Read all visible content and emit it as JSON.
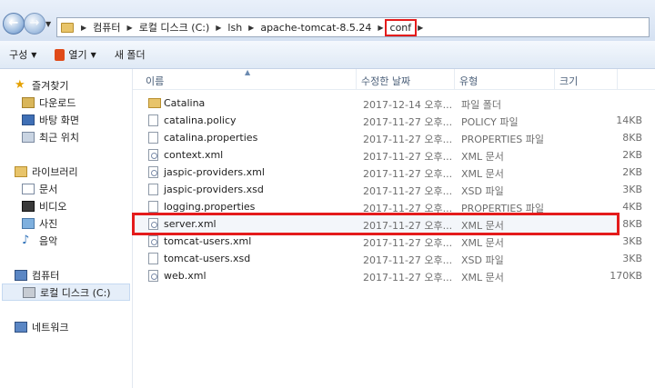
{
  "breadcrumbs": [
    "컴퓨터",
    "로컬 디스크 (C:)",
    "lsh",
    "apache-tomcat-8.5.24",
    "conf"
  ],
  "toolbar": {
    "organize": "구성",
    "open": "열기",
    "new_folder": "새 폴더"
  },
  "nav": {
    "favorites": "즐겨찾기",
    "downloads": "다운로드",
    "desktop": "바탕 화면",
    "recent": "최근 위치",
    "libraries": "라이브러리",
    "documents": "문서",
    "videos": "비디오",
    "pictures": "사진",
    "music": "음악",
    "computer": "컴퓨터",
    "local_disk": "로컬 디스크 (C:)",
    "network": "네트워크"
  },
  "columns": {
    "name": "이름",
    "date": "수정한 날짜",
    "type": "유형",
    "size": "크기"
  },
  "files": [
    {
      "name": "Catalina",
      "date": "2017-12-14 오후...",
      "type": "파일 폴더",
      "size": "",
      "icon": "folder-icon"
    },
    {
      "name": "catalina.policy",
      "date": "2017-11-27 오후...",
      "type": "POLICY 파일",
      "size": "14KB",
      "icon": "file-icon"
    },
    {
      "name": "catalina.properties",
      "date": "2017-11-27 오후...",
      "type": "PROPERTIES 파일",
      "size": "8KB",
      "icon": "file-icon"
    },
    {
      "name": "context.xml",
      "date": "2017-11-27 오후...",
      "type": "XML 문서",
      "size": "2KB",
      "icon": "xml-icon"
    },
    {
      "name": "jaspic-providers.xml",
      "date": "2017-11-27 오후...",
      "type": "XML 문서",
      "size": "2KB",
      "icon": "xml-icon"
    },
    {
      "name": "jaspic-providers.xsd",
      "date": "2017-11-27 오후...",
      "type": "XSD 파일",
      "size": "3KB",
      "icon": "file-icon"
    },
    {
      "name": "logging.properties",
      "date": "2017-11-27 오후...",
      "type": "PROPERTIES 파일",
      "size": "4KB",
      "icon": "file-icon"
    },
    {
      "name": "server.xml",
      "date": "2017-11-27 오후...",
      "type": "XML 문서",
      "size": "8KB",
      "icon": "xml-icon"
    },
    {
      "name": "tomcat-users.xml",
      "date": "2017-11-27 오후...",
      "type": "XML 문서",
      "size": "3KB",
      "icon": "xml-icon"
    },
    {
      "name": "tomcat-users.xsd",
      "date": "2017-11-27 오후...",
      "type": "XSD 파일",
      "size": "3KB",
      "icon": "file-icon"
    },
    {
      "name": "web.xml",
      "date": "2017-11-27 오후...",
      "type": "XML 문서",
      "size": "170KB",
      "icon": "xml-icon"
    }
  ],
  "highlight_color": "#e41b1b"
}
